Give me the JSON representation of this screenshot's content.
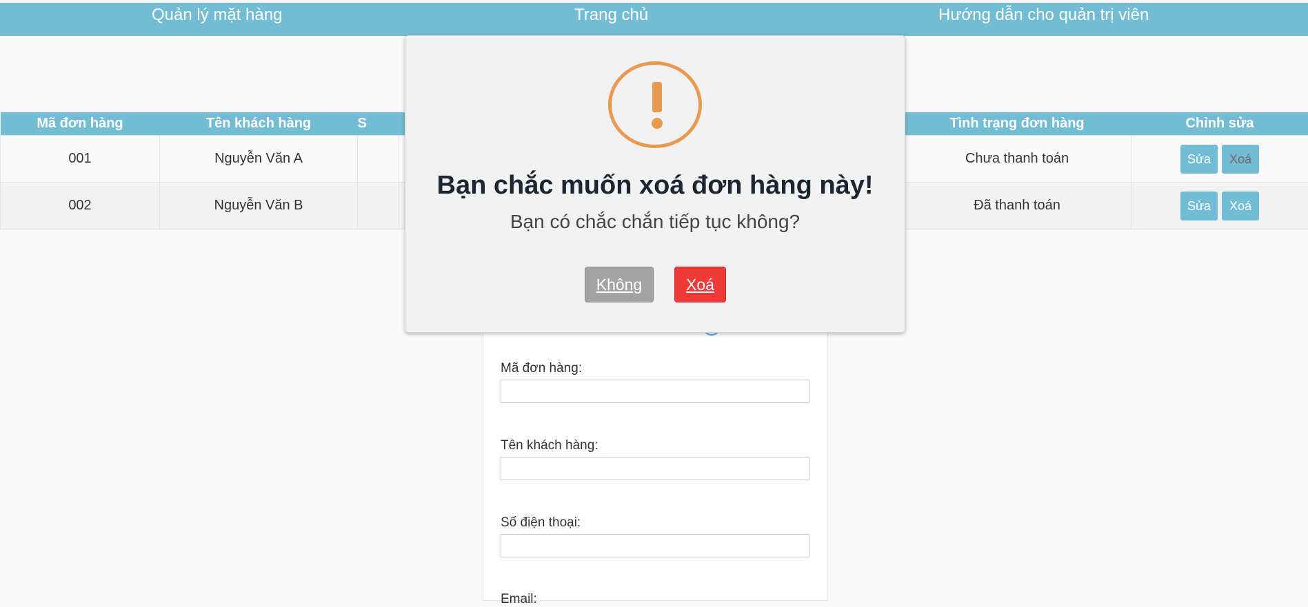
{
  "nav": {
    "items": [
      "Quản lý mặt hàng",
      "Trang chủ",
      "Hướng dẫn cho quản trị viên"
    ]
  },
  "table": {
    "headers": [
      "Mã đơn hàng",
      "Tên khách hàng",
      "S",
      "",
      "",
      "Tình trạng đơn hàng",
      "Chỉnh sửa"
    ],
    "rows": [
      {
        "id": "001",
        "name": "Nguyễn Văn A",
        "status": "Chưa thanh toán"
      },
      {
        "id": "002",
        "name": "Nguyễn Văn B",
        "status": "Đã thanh toán"
      }
    ],
    "edit_label": "Sửa",
    "delete_label": "Xoá"
  },
  "form": {
    "order_id_label": "Mã đơn hàng:",
    "customer_label": "Tên khách hàng:",
    "phone_label": "Số điện thoại:",
    "email_label": "Email:"
  },
  "modal": {
    "icon": "exclamation-circle-icon",
    "title": "Bạn chắc muốn xoá đơn hàng này!",
    "text": "Bạn có chắc chắn tiếp tục không?",
    "cancel_label": "Không",
    "confirm_label": "Xoá"
  },
  "colors": {
    "header_bg": "#72bcd4",
    "warning": "#ea9a4f",
    "danger": "#f03a3a",
    "cancel": "#a3a3a3"
  }
}
